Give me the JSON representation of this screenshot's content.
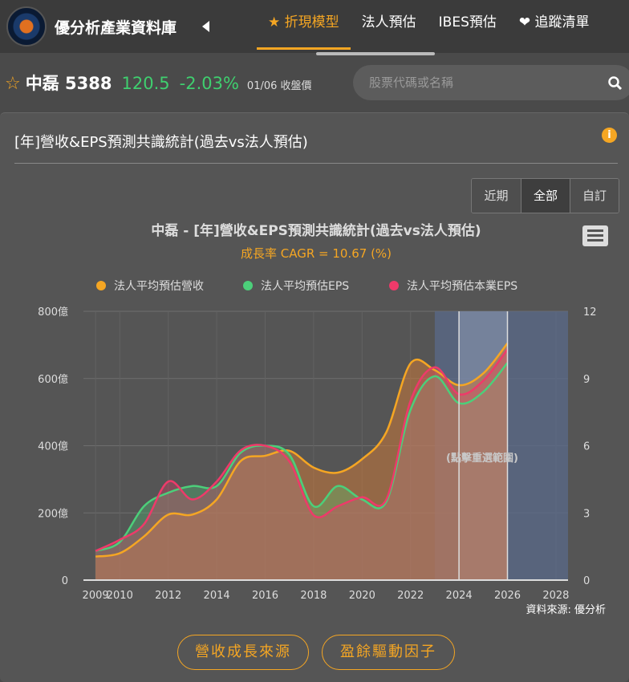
{
  "header": {
    "brand": "優分析產業資料庫",
    "nav": [
      {
        "label": "★ 折現模型",
        "active": true
      },
      {
        "label": "法人預估"
      },
      {
        "label": "IBES預估"
      },
      {
        "label": "❤ 追蹤清單"
      }
    ]
  },
  "stock": {
    "name": "中磊 5388",
    "price": "120.5",
    "change": "-2.03%",
    "date": "01/06 收盤價",
    "search_placeholder": "股票代碼或名稱"
  },
  "card": {
    "title": "[年]營收&EPS預測共識統計(過去vs法人預估)",
    "range_buttons": [
      "近期",
      "全部",
      "自訂"
    ],
    "active_range": "全部"
  },
  "chart_data": {
    "type": "area",
    "title": "中磊 - [年]營收&EPS預測共識統計(過去vs法人預估)",
    "subtitle": "成長率 CAGR = 10.67 (%)",
    "x": [
      2009,
      2010,
      2011,
      2012,
      2013,
      2014,
      2015,
      2016,
      2017,
      2018,
      2019,
      2020,
      2021,
      2022,
      2023,
      2024,
      2025,
      2026
    ],
    "xticks": [
      "2009",
      "2010",
      "2012",
      "2014",
      "2016",
      "2018",
      "2020",
      "2022",
      "2024",
      "2026",
      "2028"
    ],
    "xlim": [
      2008.5,
      2028.5
    ],
    "y_left": {
      "ticks": [
        "0",
        "200億",
        "400億",
        "600億",
        "800億"
      ],
      "range": [
        0,
        800
      ]
    },
    "y_right": {
      "ticks": [
        "0",
        "3",
        "6",
        "9",
        "12"
      ],
      "range": [
        0,
        12
      ]
    },
    "series": [
      {
        "name": "法人平均預估營收",
        "axis": "left",
        "color": "#f5a623",
        "values": [
          70,
          80,
          130,
          195,
          195,
          240,
          355,
          370,
          385,
          335,
          320,
          360,
          440,
          645,
          625,
          580,
          615,
          705
        ]
      },
      {
        "name": "法人平均預估EPS",
        "axis": "right",
        "color": "#4ccf7a",
        "values": [
          1.3,
          1.7,
          3.3,
          3.9,
          4.2,
          4.2,
          5.7,
          6.0,
          5.6,
          3.3,
          4.2,
          3.6,
          3.5,
          7.6,
          9.1,
          7.9,
          8.4,
          9.7
        ]
      },
      {
        "name": "法人平均預估本業EPS",
        "axis": "right",
        "color": "#ee3a6a",
        "values": [
          1.3,
          1.8,
          2.5,
          4.4,
          3.6,
          4.4,
          5.8,
          6.0,
          5.3,
          2.9,
          3.3,
          3.7,
          3.6,
          8.0,
          9.5,
          8.3,
          8.9,
          10.3
        ]
      }
    ],
    "forecast_band": [
      2023,
      2028.5
    ],
    "highlight_band": [
      2024,
      2026
    ],
    "band_label": "(點擊重選範圍)",
    "credit": "資料來源: 優分析",
    "legend": "top"
  },
  "buttons": [
    "營收成長來源",
    "盈餘驅動因子"
  ]
}
